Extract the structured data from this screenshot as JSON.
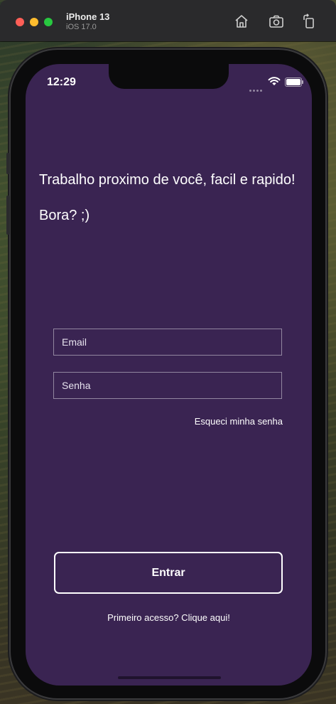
{
  "simulator": {
    "device_name": "iPhone 13",
    "os_version": "iOS 17.0",
    "icons": [
      "home-icon",
      "screenshot-icon",
      "rotate-icon"
    ]
  },
  "status_bar": {
    "time": "12:29",
    "icons": [
      "signal-icon",
      "wifi-icon",
      "battery-icon"
    ]
  },
  "main": {
    "headline": "Trabalho proximo de você, facil e rapido!",
    "subline": "Bora? ;)"
  },
  "form": {
    "email_placeholder": "Email",
    "password_placeholder": "Senha",
    "forgot_password": "Esqueci minha senha"
  },
  "actions": {
    "enter_label": "Entrar",
    "first_access": "Primeiro acesso? Clique aqui!"
  },
  "colors": {
    "screen_background": "#3a2452",
    "text": "#ffffff"
  }
}
